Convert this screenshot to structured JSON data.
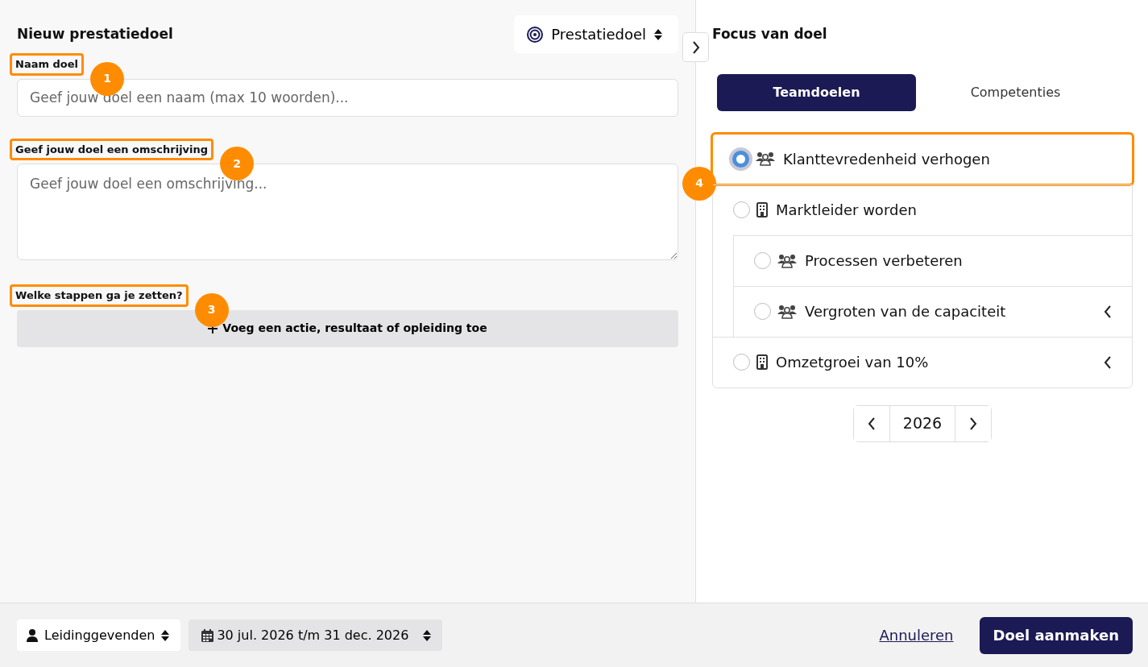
{
  "form": {
    "title": "Nieuw prestatiedoel",
    "type_select": {
      "value": "Prestatiedoel"
    },
    "fields": [
      {
        "kind": "input",
        "label": "Naam doel",
        "highlighted": true,
        "marker": "1",
        "placeholder": "Geef jouw doel een naam (max 10 woorden)..."
      },
      {
        "kind": "textarea",
        "label": "Geef jouw doel een omschrijving",
        "highlighted": true,
        "marker": "2",
        "placeholder": "Geef jouw doel een omschrijving..."
      },
      {
        "kind": "action",
        "label": "Welke stappen ga je zetten?",
        "highlighted": true,
        "marker": "3",
        "button": "Voeg een actie, resultaat of opleiding toe"
      }
    ]
  },
  "focus": {
    "title": "Focus van doel",
    "tabs": [
      {
        "label": "Teamdoelen",
        "selected": true
      },
      {
        "label": "Competenties",
        "selected": false
      }
    ],
    "goals": [
      {
        "label": "Klanttevredenheid verhogen",
        "kind": "team",
        "selected": true,
        "highlighted": true,
        "marker": "4",
        "expandable": false
      },
      {
        "label": "Marktleider worden",
        "kind": "company",
        "selected": false,
        "highlighted": false,
        "expandable": false,
        "children": [
          {
            "label": "Processen verbeteren",
            "kind": "team",
            "selected": false,
            "highlighted": false,
            "expandable": false
          },
          {
            "label": "Vergroten van de capaciteit",
            "kind": "team",
            "selected": false,
            "highlighted": false,
            "expandable": true
          }
        ]
      },
      {
        "label": "Omzetgroei van 10%",
        "kind": "company",
        "selected": false,
        "highlighted": false,
        "expandable": true
      }
    ],
    "year": "2026"
  },
  "footer": {
    "audience": "Leidinggevenden",
    "period": "30 jul. 2026 t/m 31 dec. 2026",
    "cancel": "Annuleren",
    "submit": "Doel aanmaken"
  }
}
